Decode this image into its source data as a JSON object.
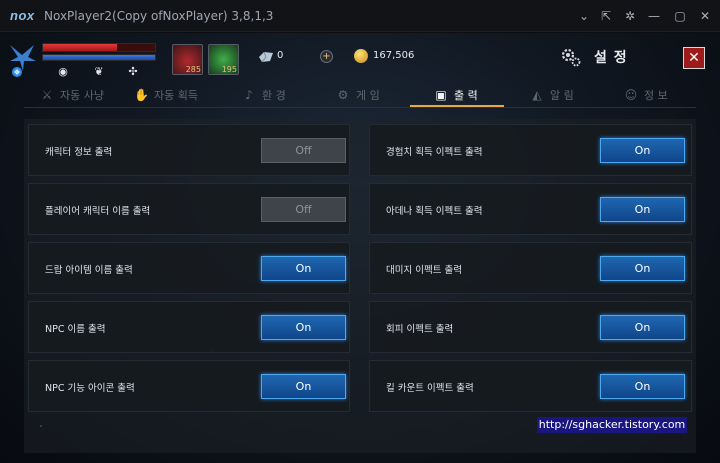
{
  "window": {
    "logo": "nox",
    "title": "NoxPlayer2(Copy ofNoxPlayer) 3,8,1,3",
    "controls": [
      {
        "name": "chevron-down-icon",
        "glyph": "⌄"
      },
      {
        "name": "pin-icon",
        "glyph": "⇱"
      },
      {
        "name": "gear-icon",
        "glyph": "✲"
      },
      {
        "name": "minimize-icon",
        "glyph": "—"
      },
      {
        "name": "maximize-icon",
        "glyph": "▢"
      },
      {
        "name": "close-icon",
        "glyph": "✕"
      }
    ]
  },
  "hud": {
    "hp_fraction": 0.66,
    "mp_fraction": 1.0,
    "potions": [
      {
        "name": "red-potion-slot",
        "count": "285",
        "color": "#b0282e"
      },
      {
        "name": "green-herb-slot",
        "count": "195",
        "color": "#2c8a3a"
      }
    ],
    "crystal": "0",
    "plus": "+",
    "gold": "167,506"
  },
  "settings": {
    "title": "설 정",
    "close": "✕"
  },
  "tabs": [
    {
      "label": "자동 사냥",
      "icon": "sword-icon",
      "glyph": "⚔",
      "active": false
    },
    {
      "label": "자동 획득",
      "icon": "bag-icon",
      "glyph": "✋",
      "active": false
    },
    {
      "label": "환 경",
      "icon": "music-note-icon",
      "glyph": "♪",
      "active": false
    },
    {
      "label": "게 임",
      "icon": "gear-icon",
      "glyph": "⚙",
      "active": false
    },
    {
      "label": "출 력",
      "icon": "box-icon",
      "glyph": "▣",
      "active": true
    },
    {
      "label": "알 림",
      "icon": "megaphone-icon",
      "glyph": "◭",
      "active": false
    },
    {
      "label": "정 보",
      "icon": "person-icon",
      "glyph": "☺",
      "active": false
    }
  ],
  "options_left": [
    {
      "label": "캐릭터 정보 출력",
      "state": "Off"
    },
    {
      "label": "플레이어 캐릭터 이름 출력",
      "state": "Off"
    },
    {
      "label": "드랍 아이템 이름 출력",
      "state": "On"
    },
    {
      "label": "NPC 이름 출력",
      "state": "On"
    },
    {
      "label": "NPC 기능 아이콘 출력",
      "state": "On"
    }
  ],
  "options_right": [
    {
      "label": "경험치 획득 이펙트 출력",
      "state": "On"
    },
    {
      "label": "아데나 획득 이펙트 출력",
      "state": "On"
    },
    {
      "label": "대미지 이펙트 출력",
      "state": "On"
    },
    {
      "label": "회피 이펙트 출력",
      "state": "On"
    },
    {
      "label": "킬 카운트 이펙트 출력",
      "state": "On"
    }
  ],
  "watermark": "http://sghacker.tistory.com"
}
